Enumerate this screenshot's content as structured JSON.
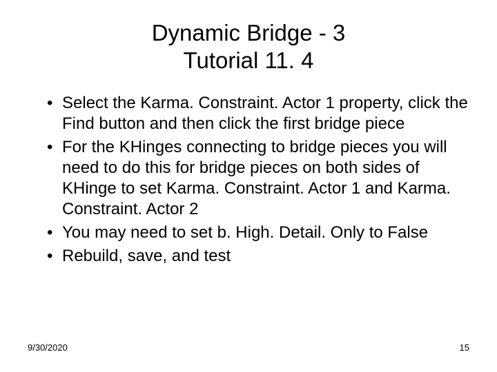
{
  "title_line1": "Dynamic Bridge - 3",
  "title_line2": "Tutorial 11. 4",
  "bullets": [
    "Select the Karma. Constraint. Actor 1 property, click the Find button and then click the first bridge piece",
    "For the KHinges connecting to bridge pieces you will need to do this for bridge pieces on both sides of KHinge to set Karma. Constraint. Actor 1 and Karma. Constraint. Actor 2",
    "You may need to set b. High. Detail. Only to False",
    "Rebuild, save, and test"
  ],
  "footer": {
    "date": "9/30/2020",
    "page": "15"
  }
}
